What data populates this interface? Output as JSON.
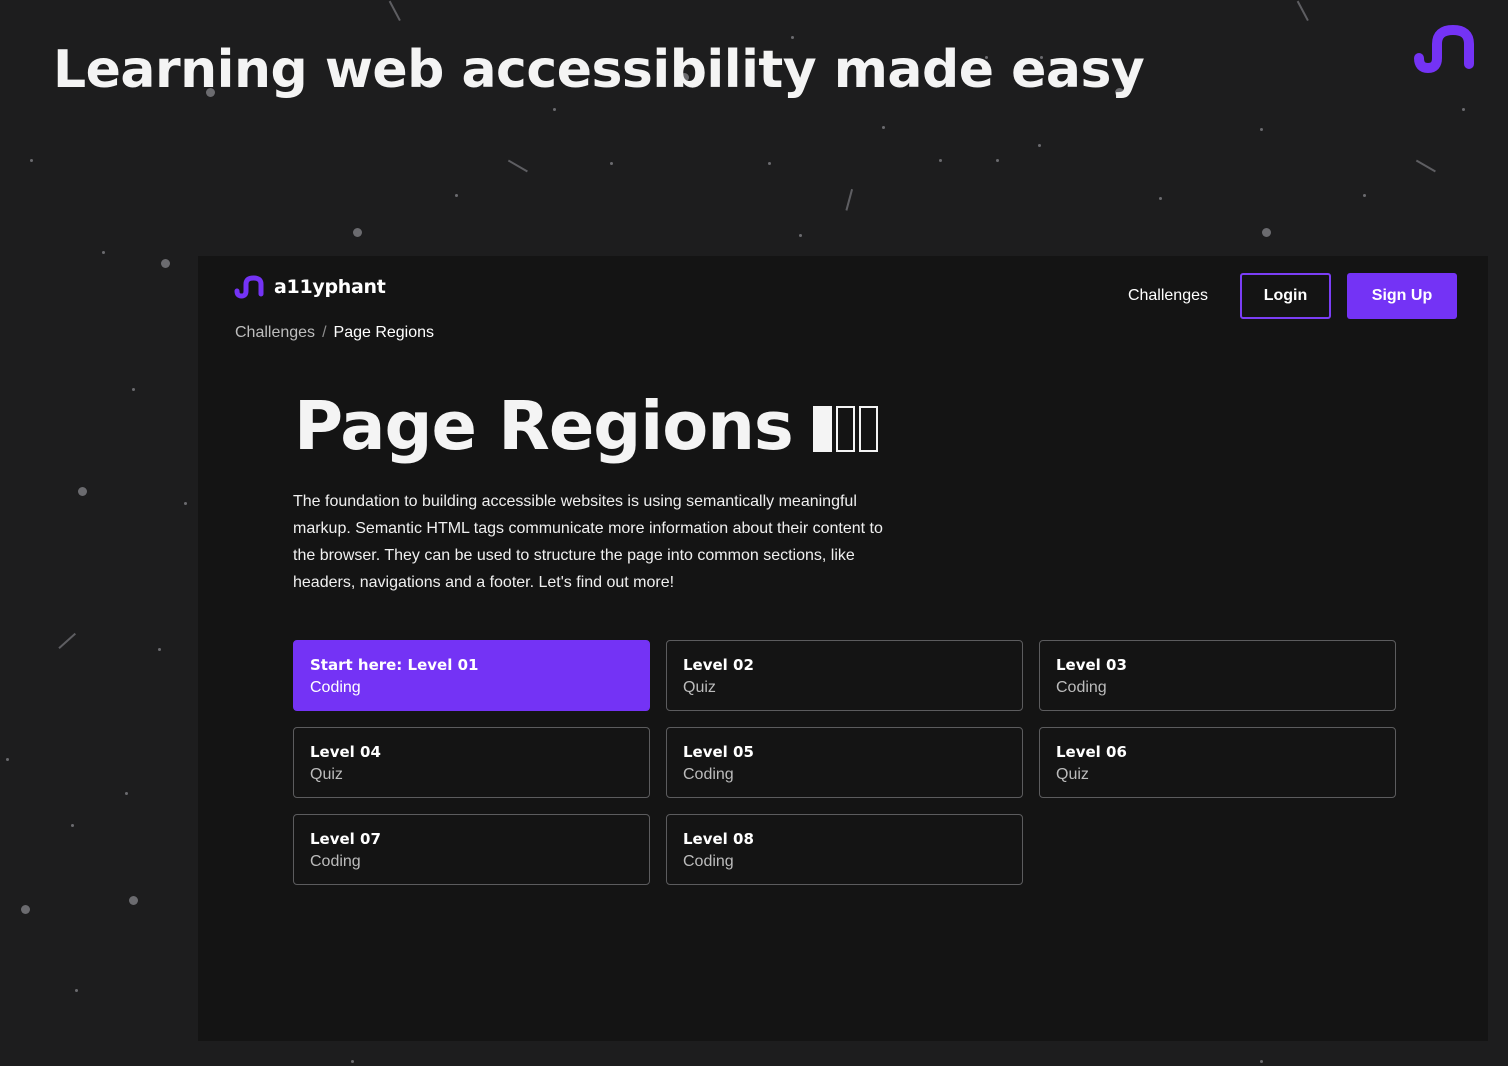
{
  "hero": {
    "headline": "Learning web accessibility made easy"
  },
  "header": {
    "brand_name": "a11yphant",
    "nav": {
      "challenges": "Challenges",
      "login": "Login",
      "signup": "Sign Up"
    }
  },
  "breadcrumb": {
    "parent": "Challenges",
    "separator": "/",
    "current": "Page Regions"
  },
  "challenge": {
    "title": "Page Regions",
    "difficulty": {
      "filled": 1,
      "total": 3
    },
    "description": "The foundation to building accessible websites is using semantically meaningful markup. Semantic HTML tags communicate more information about their content to the browser. They can be used to structure the page into common sections, like headers, navigations and a footer. Let's find out more!"
  },
  "levels": [
    {
      "name": "Start here: Level 01",
      "type": "Coding",
      "active": true
    },
    {
      "name": "Level 02",
      "type": "Quiz"
    },
    {
      "name": "Level 03",
      "type": "Coding"
    },
    {
      "name": "Level 04",
      "type": "Quiz"
    },
    {
      "name": "Level 05",
      "type": "Coding"
    },
    {
      "name": "Level 06",
      "type": "Quiz"
    },
    {
      "name": "Level 07",
      "type": "Coding"
    },
    {
      "name": "Level 08",
      "type": "Coding"
    }
  ],
  "colors": {
    "accent": "#7433f5",
    "background": "#1d1d1e",
    "panel": "#141414"
  },
  "icons": {
    "logo": "a11yphant-trunk-icon"
  }
}
